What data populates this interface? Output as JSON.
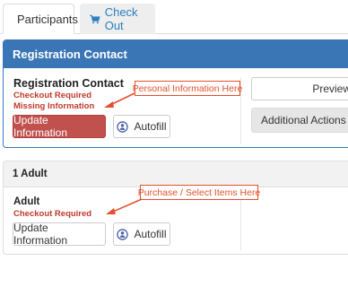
{
  "tabs": {
    "participants_label": "Participants",
    "checkout_label": "Check Out"
  },
  "registration_panel": {
    "header": "Registration Contact",
    "contact_title": "Registration Contact",
    "checkout_required": "Checkout Required",
    "missing_info": "Missing Information",
    "update_button": "Update Information",
    "autofill_button": "Autofill",
    "preview_button": "Preview",
    "additional_actions": "Additional Actions"
  },
  "adult_panel": {
    "header": "1 Adult",
    "adult_title": "Adult",
    "checkout_required": "Checkout Required",
    "update_button": "Update Information",
    "autofill_button": "Autofill"
  },
  "annotations": {
    "personal_info": "Personal Information Here",
    "purchase_items": "Purchase / Select Items Here"
  },
  "colors": {
    "panel_blue": "#3a76b5",
    "button_red": "#c0514d",
    "required_red": "#c0392b",
    "annotation_orange": "#e4502d",
    "tab_link_blue": "#2a7fc1"
  }
}
